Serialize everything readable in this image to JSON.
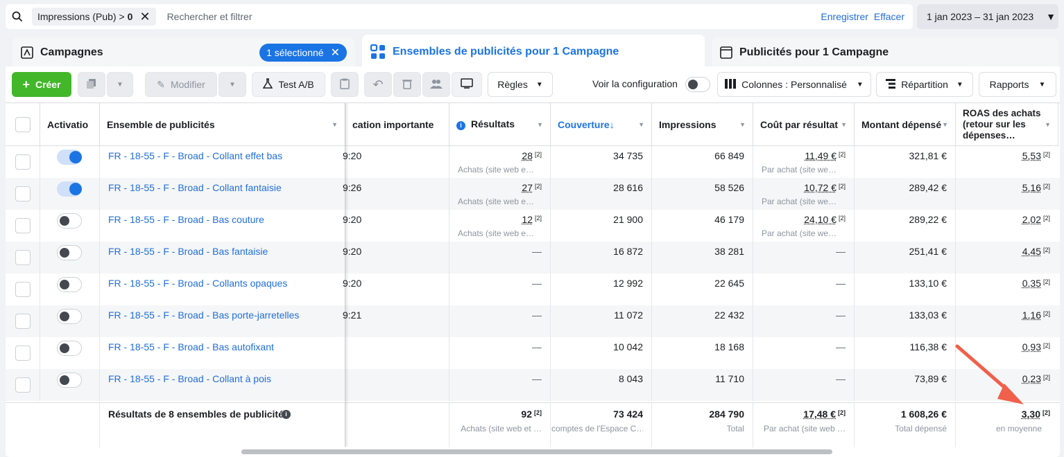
{
  "search": {
    "filter_label": "Impressions (Pub) >",
    "filter_value": "0",
    "placeholder": "Rechercher et filtrer",
    "save": "Enregistrer",
    "clear": "Effacer"
  },
  "date_range": "1 jan 2023 – 31 jan 2023",
  "tabs": {
    "campaigns": "Campagnes",
    "selected": "1 sélectionné",
    "adsets": "Ensembles de publicités pour 1 Campagne",
    "ads": "Publicités pour 1 Campagne"
  },
  "toolbar": {
    "create": "Créer",
    "edit": "Modifier",
    "abtest": "Test A/B",
    "rules": "Règles",
    "view_config": "Voir la configuration",
    "columns": "Colonnes : Personnalisé",
    "breakdown": "Répartition",
    "reports": "Rapports"
  },
  "headers": {
    "activation": "Activatio",
    "adset": "Ensemble de publicités",
    "last_edit": "cation importante",
    "results": "Résultats",
    "reach": "Couverture",
    "impressions": "Impressions",
    "cost_per_result": "Coût par résultat",
    "amount_spent": "Montant dépensé",
    "roas": "ROAS des achats (retour sur les dépenses…"
  },
  "rows": [
    {
      "on": true,
      "name": "FR - 18-55 - F - Broad - Collant effet bas",
      "time": "9:20",
      "results": "28",
      "results_sub": "Achats (site web e…",
      "reach": "34 735",
      "impressions": "66 849",
      "cpr": "11,49 €",
      "cpr_sub": "Par achat (site we…",
      "spent": "321,81 €",
      "roas": "5,53"
    },
    {
      "on": true,
      "name": "FR - 18-55 - F - Broad - Collant fantaisie",
      "time": "9:26",
      "results": "27",
      "results_sub": "Achats (site web e…",
      "reach": "28 616",
      "impressions": "58 526",
      "cpr": "10,72 €",
      "cpr_sub": "Par achat (site we…",
      "spent": "289,42 €",
      "roas": "5,16"
    },
    {
      "on": false,
      "name": "FR - 18-55 - F - Broad - Bas couture",
      "time": "9:20",
      "results": "12",
      "results_sub": "Achats (site web e…",
      "reach": "21 900",
      "impressions": "46 179",
      "cpr": "24,10 €",
      "cpr_sub": "Par achat (site we…",
      "spent": "289,22 €",
      "roas": "2,02"
    },
    {
      "on": false,
      "name": "FR - 18-55 - F - Broad - Bas fantaisie",
      "time": "9:20",
      "results": "—",
      "results_sub": "",
      "reach": "16 872",
      "impressions": "38 281",
      "cpr": "—",
      "cpr_sub": "",
      "spent": "251,41 €",
      "roas": "4,45"
    },
    {
      "on": false,
      "name": "FR - 18-55 - F - Broad - Collants opaques",
      "time": "9:20",
      "results": "—",
      "results_sub": "",
      "reach": "12 992",
      "impressions": "22 645",
      "cpr": "—",
      "cpr_sub": "",
      "spent": "133,10 €",
      "roas": "0,35"
    },
    {
      "on": false,
      "name": "FR - 18-55 - F - Broad - Bas porte-jarretelles",
      "time": "9:21",
      "results": "—",
      "results_sub": "",
      "reach": "11 072",
      "impressions": "22 432",
      "cpr": "—",
      "cpr_sub": "",
      "spent": "133,03 €",
      "roas": "1,16"
    },
    {
      "on": false,
      "name": "FR - 18-55 - F - Broad - Bas autofixant",
      "time": "",
      "results": "—",
      "results_sub": "",
      "reach": "10 042",
      "impressions": "18 168",
      "cpr": "—",
      "cpr_sub": "",
      "spent": "116,38 €",
      "roas": "0,93"
    },
    {
      "on": false,
      "name": "FR - 18-55 - F - Broad - Collant à pois",
      "time": "",
      "results": "—",
      "results_sub": "",
      "reach": "8 043",
      "impressions": "11 710",
      "cpr": "—",
      "cpr_sub": "",
      "spent": "73,89 €",
      "roas": "0,23"
    }
  ],
  "sup": "[2]",
  "totals": {
    "label": "Résultats de 8 ensembles de publicités",
    "results": "92",
    "results_sub": "Achats (site web et …",
    "reach": "73 424",
    "reach_sub": "comptes de l'Espace C…",
    "impressions": "284 790",
    "impressions_sub": "Total",
    "cpr": "17,48 €",
    "cpr_sub": "Par achat (site web …",
    "spent": "1 608,26 €",
    "spent_sub": "Total dépensé",
    "roas": "3,30",
    "roas_sub": "en moyenne"
  },
  "colors": {
    "accent": "#1b74e4",
    "create": "#42b72a",
    "link": "#216fdb",
    "arrow": "#f0604a"
  }
}
